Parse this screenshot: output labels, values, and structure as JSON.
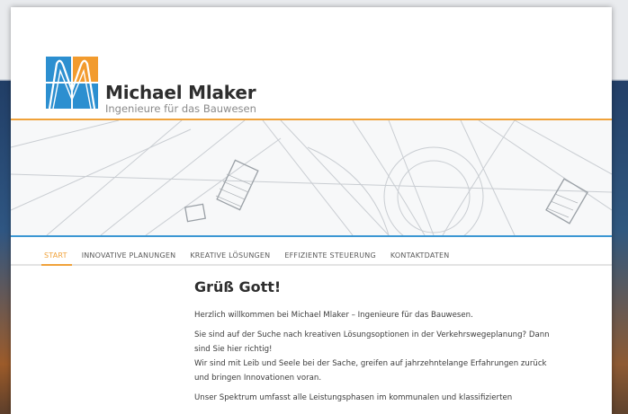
{
  "brand": {
    "name": "Michael Mlaker",
    "tagline": "Ingenieure für das Bauwesen",
    "colors": {
      "orange": "#f0a23a",
      "blue": "#3b97d3",
      "logo_blue": "#2c8fd0",
      "logo_orange": "#f29b2e"
    }
  },
  "nav": {
    "items": [
      {
        "label": "START",
        "active": true
      },
      {
        "label": "INNOVATIVE PLANUNGEN",
        "active": false
      },
      {
        "label": "KREATIVE LÖSUNGEN",
        "active": false
      },
      {
        "label": "EFFIZIENTE STEUERUNG",
        "active": false
      },
      {
        "label": "KONTAKTDATEN",
        "active": false
      }
    ]
  },
  "content": {
    "heading": "Grüß Gott!",
    "p1": "Herzlich willkommen bei Michael Mlaker – Ingenieure für das Bauwesen.",
    "p2_l1": "Sie sind auf der Suche nach kreativen Lösungsoptionen in der Verkehrswegeplanung?    Dann",
    "p2_l2": "sind Sie hier richtig!",
    "p2_l3": "Wir sind mit Leib und Seele bei der Sache, greifen auf jahrzehntelange Erfahrungen zurück",
    "p2_l4": "und bringen Innovationen voran.",
    "p3_l1": "Unser Spektrum umfasst alle Leistungsphasen im kommunalen und klassifizierten"
  }
}
